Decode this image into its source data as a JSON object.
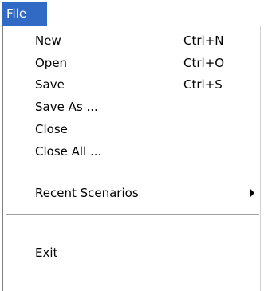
{
  "menubar": {
    "active_menu": "File"
  },
  "file_menu": {
    "items": [
      {
        "label": "New",
        "shortcut": "Ctrl+N"
      },
      {
        "label": "Open",
        "shortcut": "Ctrl+O"
      },
      {
        "label": "Save",
        "shortcut": "Ctrl+S"
      },
      {
        "label": "Save As ...",
        "shortcut": ""
      },
      {
        "label": "Close",
        "shortcut": ""
      },
      {
        "label": "Close All ...",
        "shortcut": ""
      }
    ],
    "recent": {
      "label": "Recent Scenarios",
      "has_submenu": true
    },
    "exit": {
      "label": "Exit"
    }
  },
  "colors": {
    "menubar_highlight": "#316ac5",
    "menu_background": "#ffffff",
    "separator": "#a0a0a0"
  }
}
